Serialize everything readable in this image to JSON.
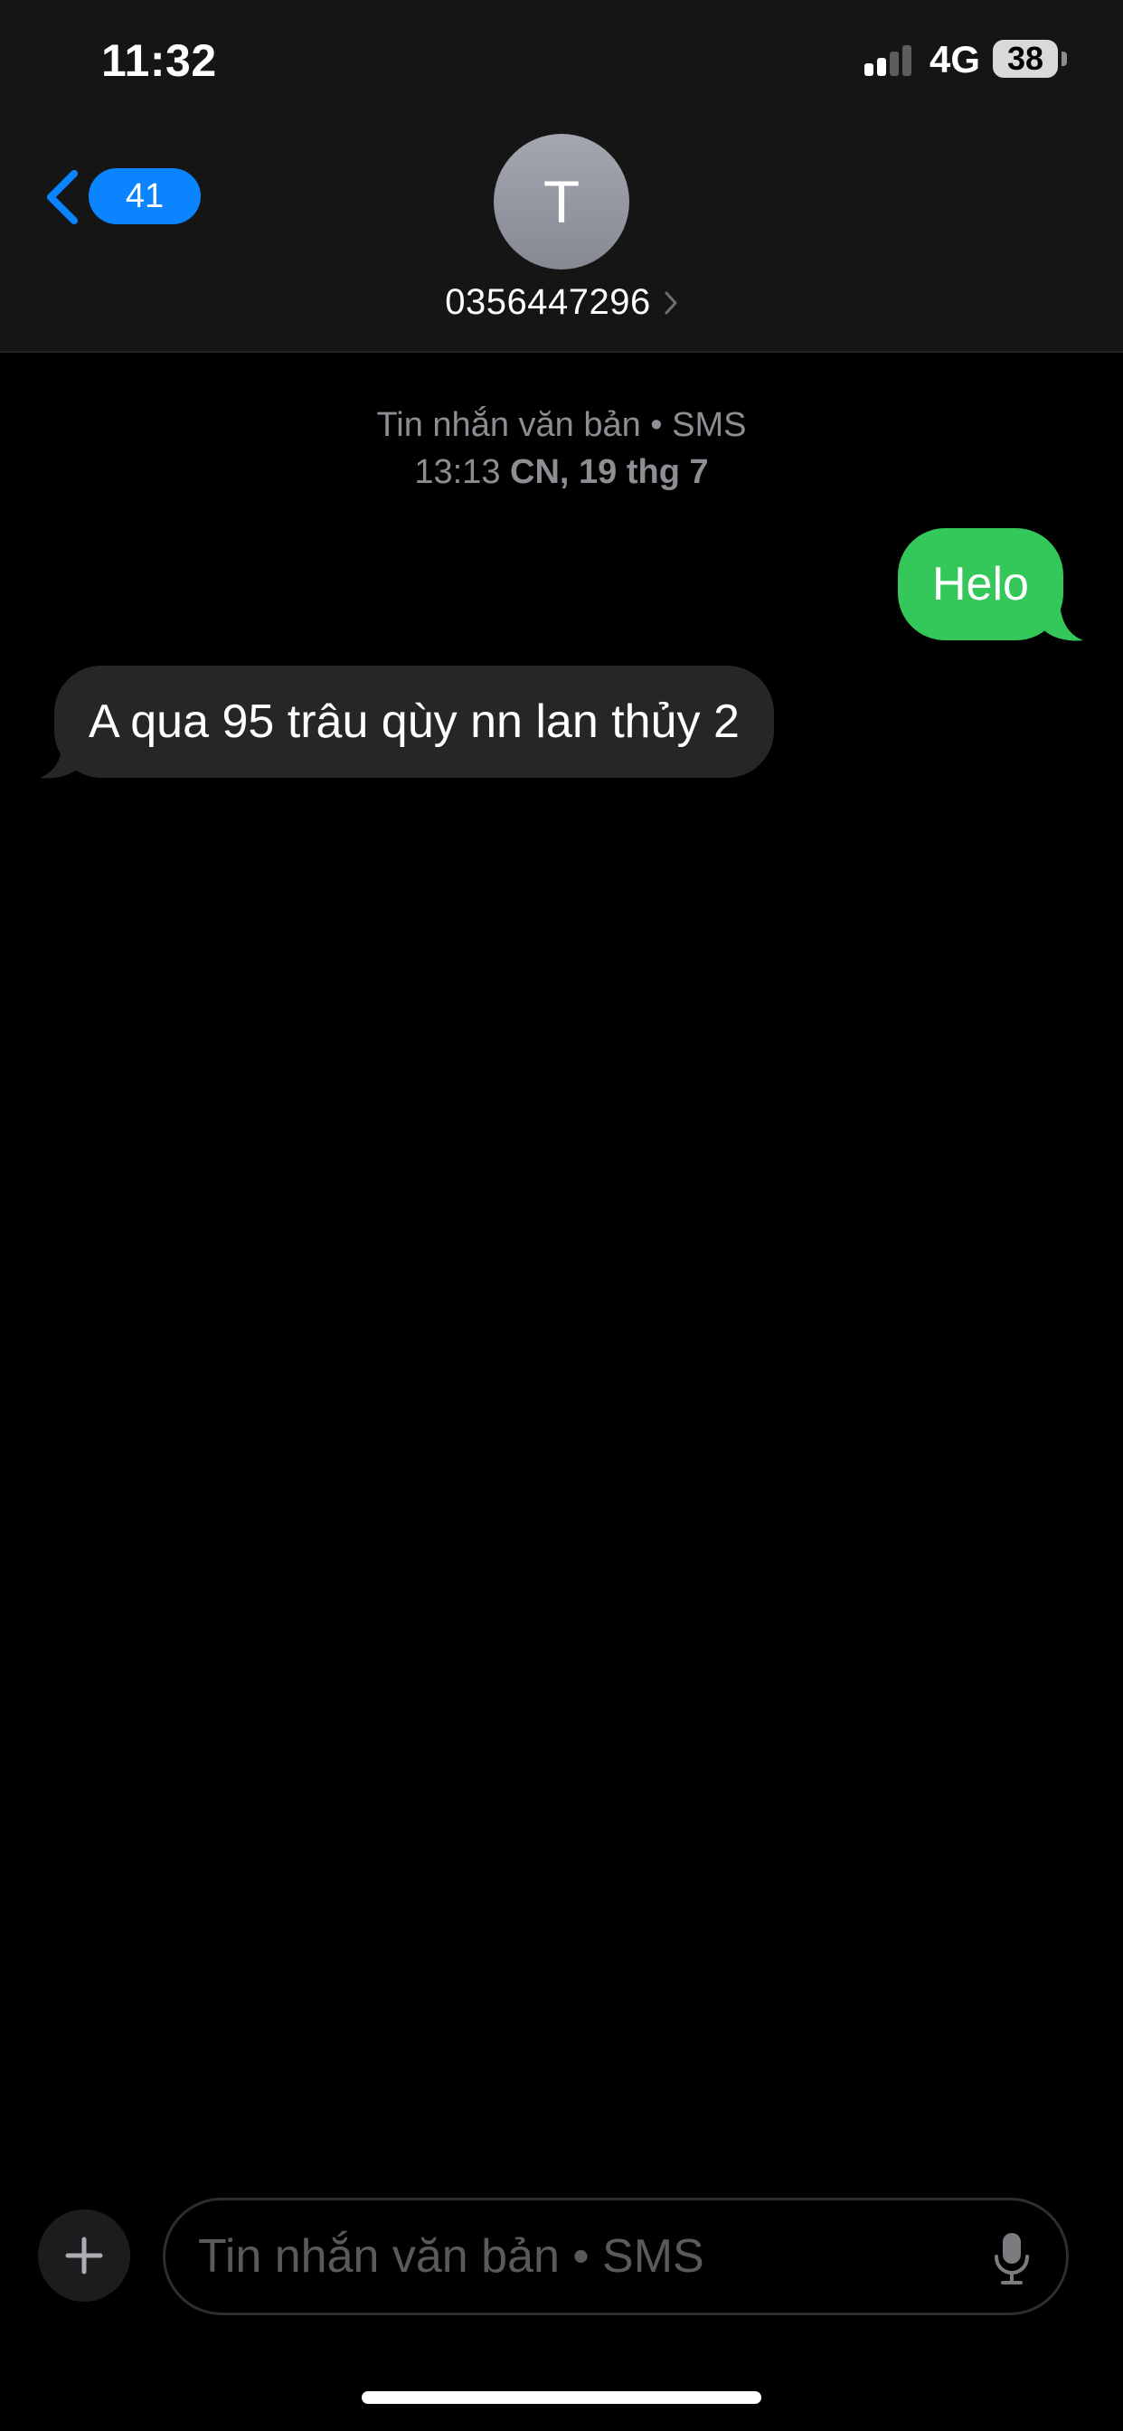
{
  "status_bar": {
    "time": "11:32",
    "network": "4G",
    "battery": "38",
    "signal_bars_active": 2,
    "signal_bars_total": 4
  },
  "header": {
    "back_badge": "41",
    "avatar_initial": "T",
    "contact_number": "0356447296",
    "icons": [
      "chevron-left-icon",
      "chevron-right-icon"
    ]
  },
  "conversation": {
    "meta_line1": "Tin nhắn văn bản • SMS",
    "meta_time": "13:13",
    "meta_date": "CN, 19 thg 7",
    "messages": [
      {
        "direction": "outgoing",
        "text": "Helo"
      },
      {
        "direction": "incoming",
        "text": "A qua 95 trâu qùy nn lan thủy 2"
      }
    ]
  },
  "composer": {
    "placeholder": "Tin nhắn văn bản • SMS",
    "value": "",
    "icons": [
      "plus-icon",
      "microphone-icon"
    ]
  },
  "colors": {
    "header_bg": "#151515",
    "accent_blue": "#0a84ff",
    "outgoing_bubble": "#34c759",
    "incoming_bubble": "#262628",
    "meta_text": "#8d8d93"
  }
}
